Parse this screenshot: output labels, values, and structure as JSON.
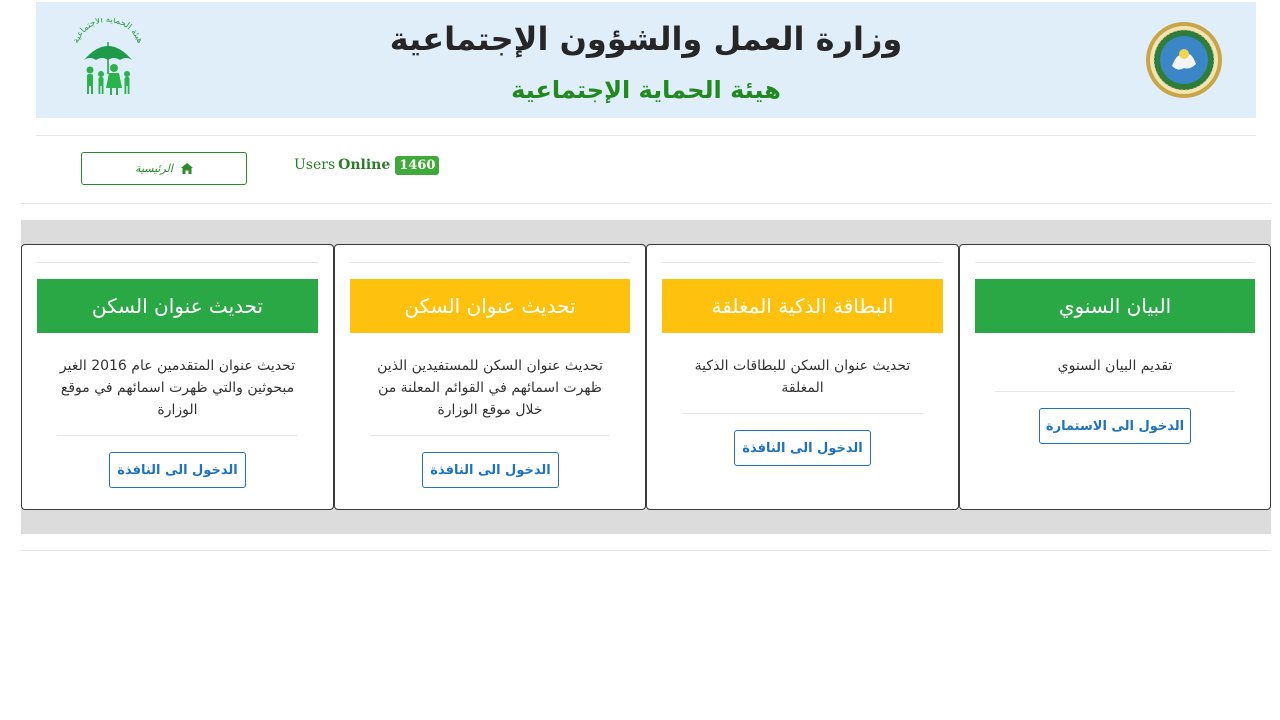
{
  "header": {
    "title": "وزارة العمل والشؤون الإجتماعية",
    "subtitle": "هيئة الحماية الإجتماعية",
    "logo_left_text": "هيئة الحماية الاجتماعية",
    "logo_left_icon": "umbrella-family-icon",
    "seal_right_icon": "ministry-seal-icon"
  },
  "nav": {
    "home_label": "الرئيسية",
    "home_icon": "home-icon",
    "users_label": "Users",
    "online_label": "Online",
    "online_count": "1460"
  },
  "colors": {
    "green": "#2aa845",
    "yellow": "#fdc10e",
    "blue": "#1e73be",
    "header_bg": "#e0eefa"
  },
  "cards": [
    {
      "title": "البيان السنوي",
      "title_color": "#2aa845",
      "description": "تقديم البيان السنوي",
      "button_label": "الدخول الى الاستمارة"
    },
    {
      "title": "البطاقة الذكية المغلقة",
      "title_color": "#fdc10e",
      "description": "تحديث عنوان السكن للبطاقات الذكية المغلقة",
      "button_label": "الدخول الى النافذة"
    },
    {
      "title": "تحديث عنوان السكن",
      "title_color": "#fdc10e",
      "description": "تحديث عنوان السكن للمستفيدين الذين ظهرت اسمائهم في القوائم المعلنة من خلال موقع الوزارة",
      "button_label": "الدخول الى النافذة"
    },
    {
      "title": "تحديث عنوان السكن",
      "title_color": "#2aa845",
      "description": "تحديث عنوان المتقدمين عام 2016 الغير مبحوثين والتي ظهرت اسمائهم في موقع الوزارة",
      "button_label": "الدخول الى النافذة"
    }
  ]
}
